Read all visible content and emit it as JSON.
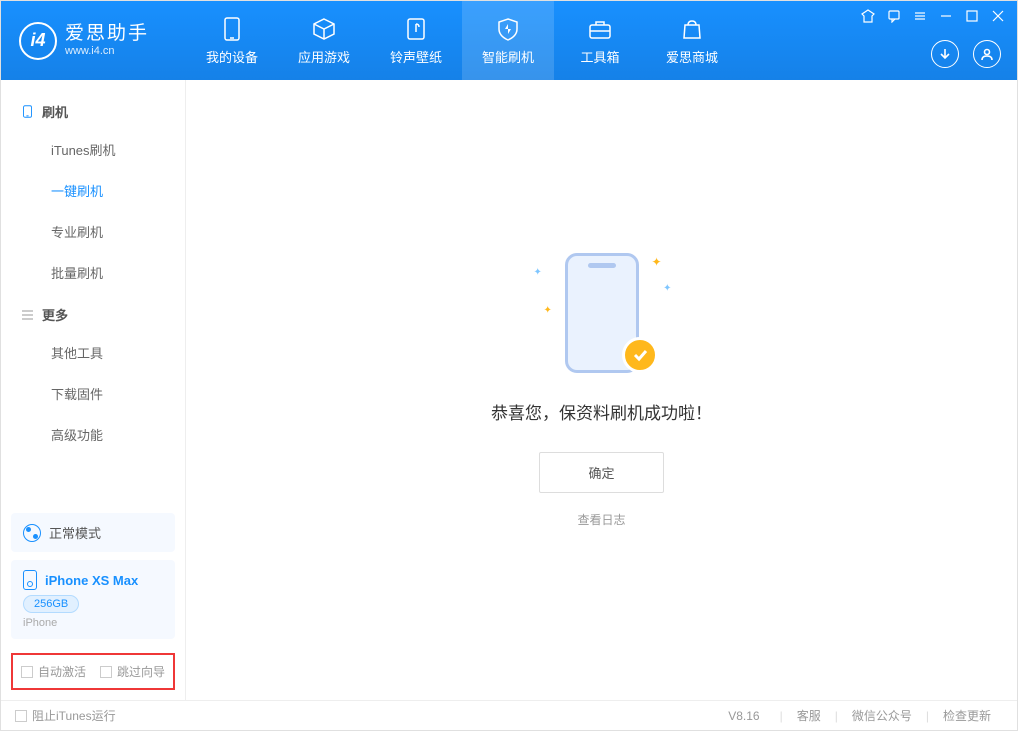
{
  "app": {
    "title": "爱思助手",
    "subtitle": "www.i4.cn"
  },
  "nav": {
    "device": "我的设备",
    "apps": "应用游戏",
    "ringtones": "铃声壁纸",
    "flash": "智能刷机",
    "toolbox": "工具箱",
    "store": "爱思商城"
  },
  "sidebar": {
    "group1": "刷机",
    "items1": {
      "itunes": "iTunes刷机",
      "onekey": "一键刷机",
      "pro": "专业刷机",
      "batch": "批量刷机"
    },
    "group2": "更多",
    "items2": {
      "other": "其他工具",
      "firmware": "下载固件",
      "advanced": "高级功能"
    }
  },
  "device": {
    "mode": "正常模式",
    "name": "iPhone XS Max",
    "capacity": "256GB",
    "type": "iPhone"
  },
  "options": {
    "auto_activate": "自动激活",
    "skip_guide": "跳过向导"
  },
  "main": {
    "message": "恭喜您，保资料刷机成功啦！",
    "ok": "确定",
    "log": "查看日志"
  },
  "footer": {
    "block_itunes": "阻止iTunes运行",
    "version": "V8.16",
    "support": "客服",
    "wechat": "微信公众号",
    "update": "检查更新"
  }
}
